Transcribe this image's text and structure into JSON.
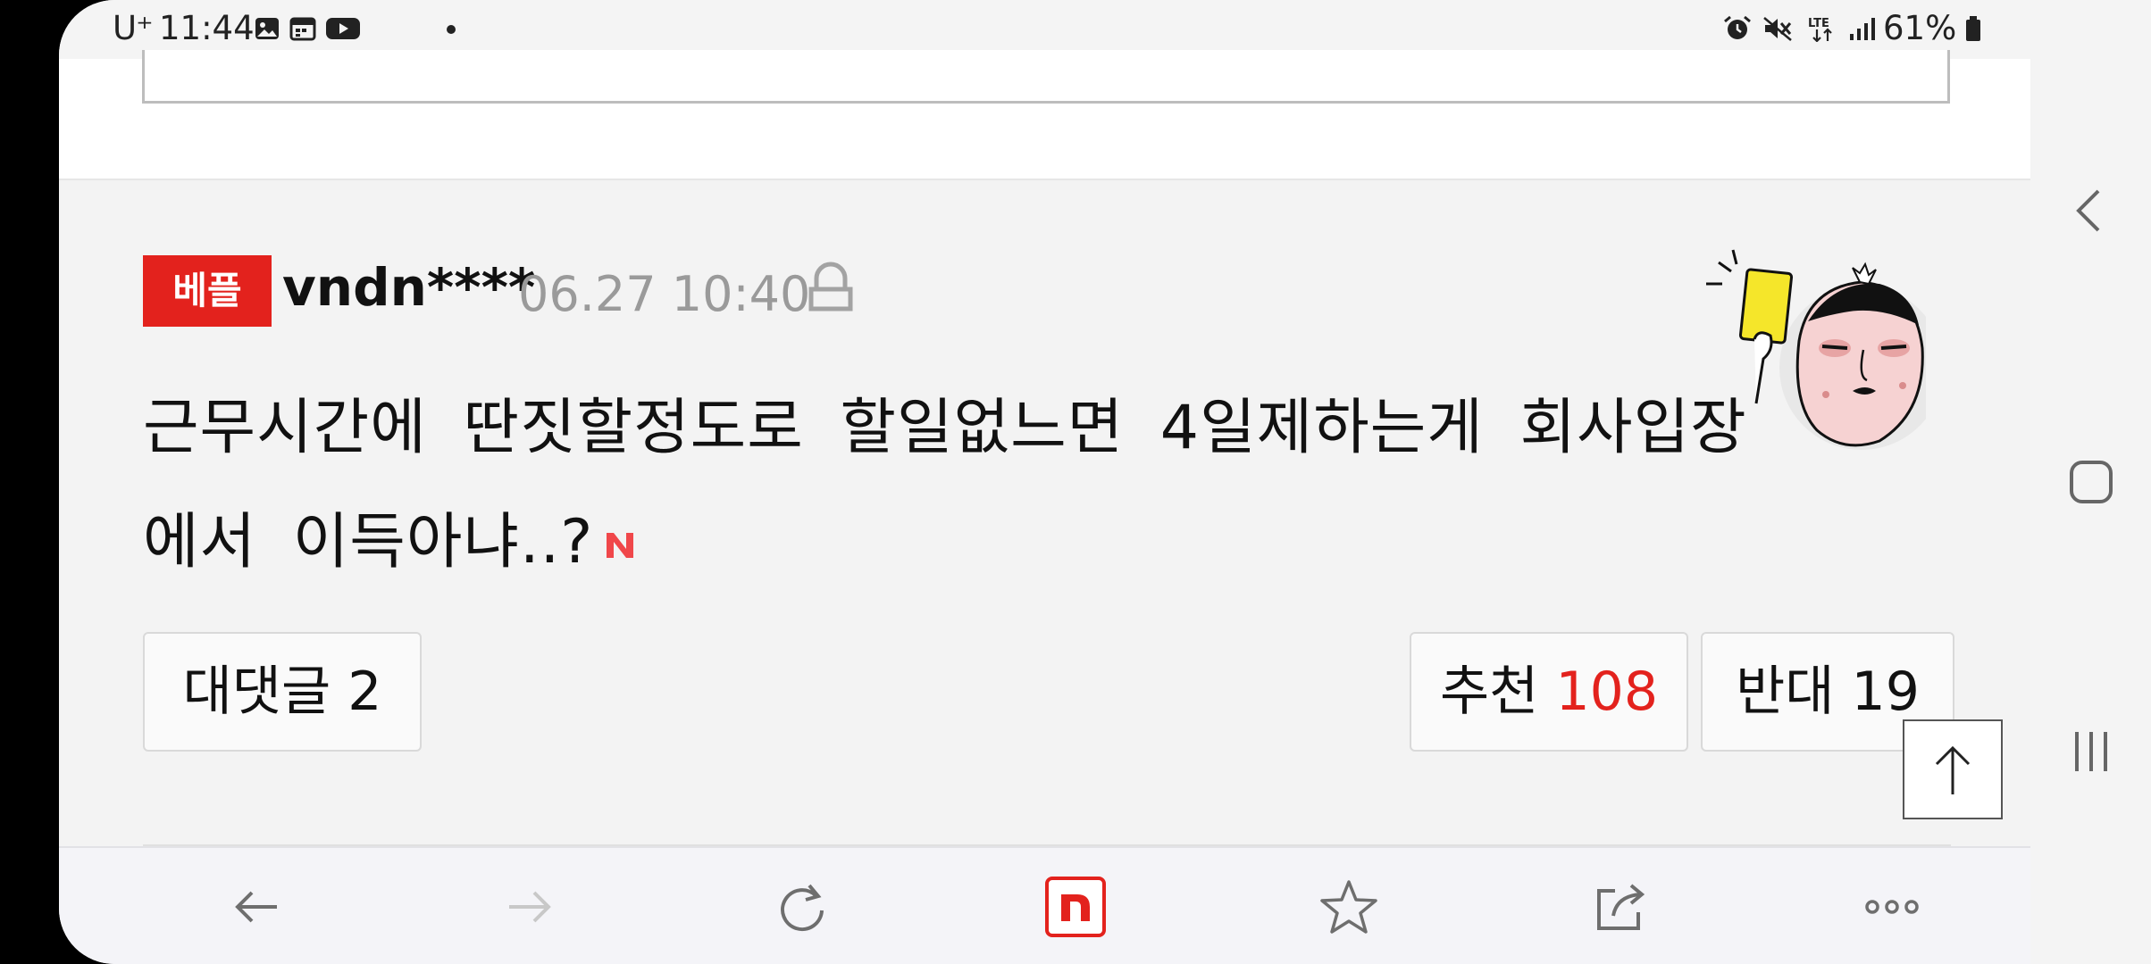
{
  "status_bar": {
    "carrier": "U⁺",
    "time": "11:44",
    "left_icons": [
      "gallery-icon",
      "calendar-icon",
      "youtube-icon",
      "dot-icon"
    ],
    "right_icons": [
      "alarm-icon",
      "mute-icon",
      "lte-icon",
      "signal-icon",
      "battery-icon"
    ],
    "network": "LTE",
    "battery": "61%"
  },
  "comment": {
    "badge": "베플",
    "username": "vndn****",
    "date": "06.27 10:40",
    "text": "근무시간에 딴짓할정도로 할일없느면 4일제하는게 회사입장에서 이득아냐..?",
    "reply_label": "대댓글 2",
    "like_label": "추천",
    "like_count": "108",
    "dislike_label": "반대 19"
  },
  "toolbar": {
    "items": [
      "back-icon",
      "forward-icon",
      "refresh-icon",
      "naver-home-icon",
      "bookmark-star-icon",
      "share-icon",
      "more-icon"
    ]
  },
  "nav_bar": {
    "items": [
      "nav-back-icon",
      "nav-home-icon",
      "nav-recents-icon"
    ]
  },
  "colors": {
    "accent_red": "#e3221d",
    "background": "#f3f3f3",
    "text": "#111111",
    "muted_text": "#9a9a9a"
  }
}
